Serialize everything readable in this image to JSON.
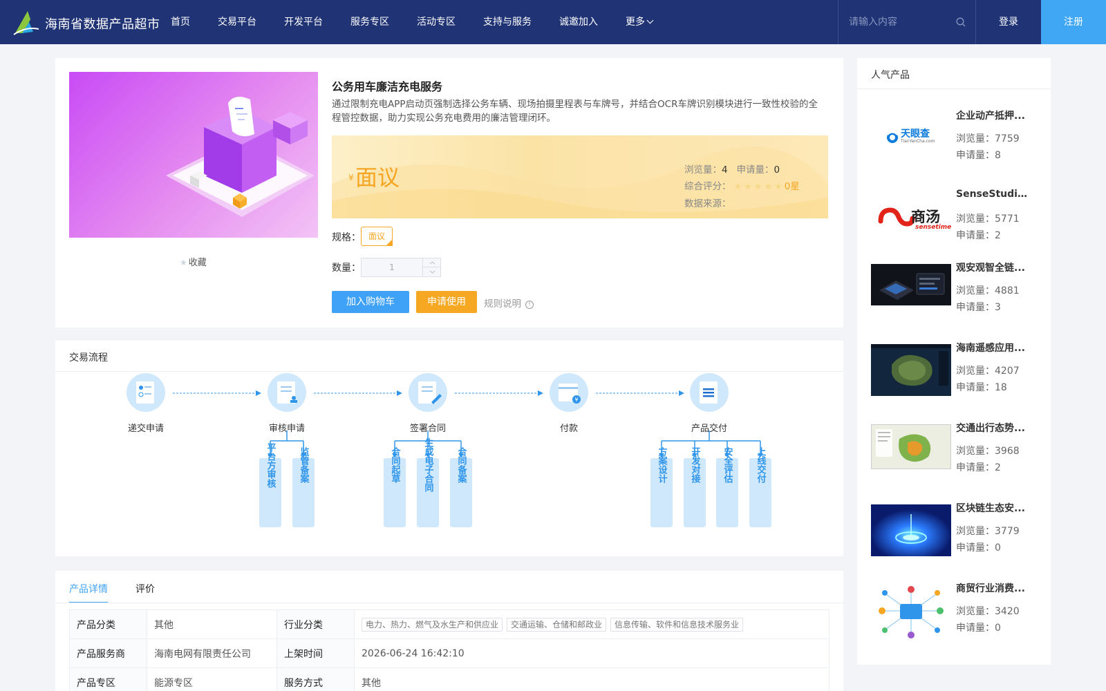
{
  "header": {
    "brand": "海南省数据产品超市",
    "nav": [
      "首页",
      "交易平台",
      "开发平台",
      "服务专区",
      "活动专区",
      "支持与服务",
      "诚邀加入",
      "更多"
    ],
    "search_placeholder": "请输入内容",
    "login": "登录",
    "register": "注册",
    "colors": {
      "bar": "#1f3375",
      "accent": "#3fa7f4"
    }
  },
  "product": {
    "favorite": "收藏",
    "title": "公务用车廉洁充电服务",
    "description": "通过限制充电APP启动页强制选择公务车辆、现场拍摄里程表与车牌号，并结合OCR车牌识别模块进行一致性校验的全程管控数据，助力实现公务充电费用的廉洁管理闭环。",
    "currency": "¥",
    "price": "面议",
    "views_label": "浏览量：",
    "views": "4",
    "applies_label": "申请量：",
    "applies": "0",
    "rating_label": "综合评分：",
    "rating_stars": 0,
    "rating_text": "0星",
    "source_label": "数据来源：",
    "spec_label": "规格：",
    "spec_value": "面议",
    "qty_label": "数量：",
    "qty_value": "1",
    "cart_button": "加入购物车",
    "apply_button": "申请使用",
    "rules_link": "规则说明"
  },
  "flow": {
    "title": "交易流程",
    "steps": [
      "递交申请",
      "审核申请",
      "签署合同",
      "付款",
      "产品交付"
    ],
    "substeps": {
      "审核申请": [
        "平台方审核",
        "监管备案"
      ],
      "签署合同": [
        "合同起草",
        "生成电子合同",
        "合同备案"
      ],
      "产品交付": [
        "方案设计",
        "开发对接",
        "安全评估",
        "上线交付"
      ]
    }
  },
  "detail": {
    "tabs": [
      "产品详情",
      "评价"
    ],
    "rows": [
      {
        "k1": "产品分类",
        "v1": "其他",
        "k2": "行业分类",
        "tags": [
          "电力、热力、燃气及水生产和供应业",
          "交通运输、仓储和邮政业",
          "信息传输、软件和信息技术服务业"
        ]
      },
      {
        "k1": "产品服务商",
        "v1": "海南电网有限责任公司",
        "k2": "上架时间",
        "v2": "2026-06-24 16:42:10"
      },
      {
        "k1": "产品专区",
        "v1": "能源专区",
        "k2": "服务方式",
        "v2": "其他"
      }
    ]
  },
  "sidebar": {
    "title": "人气产品",
    "views_label": "浏览量：",
    "applies_label": "申请量：",
    "items": [
      {
        "name": "企业动产抵押...",
        "views": "7759",
        "applies": "8",
        "thumb": "tianyancha-logo",
        "logo_text": "天眼查",
        "logo_sub": "TianYanCha.com"
      },
      {
        "name": "SenseStudio...",
        "views": "5771",
        "applies": "2",
        "thumb": "sensetime-logo",
        "logo_text": "商汤",
        "logo_sub": "sensetime"
      },
      {
        "name": "观安观智全链...",
        "views": "4881",
        "applies": "3",
        "thumb": "dark-dashboard"
      },
      {
        "name": "海南遥感应用...",
        "views": "4207",
        "applies": "18",
        "thumb": "satellite-map"
      },
      {
        "name": "交通出行态势...",
        "views": "3968",
        "applies": "2",
        "thumb": "traffic-map"
      },
      {
        "name": "区块链生态安...",
        "views": "3779",
        "applies": "0",
        "thumb": "blockchain-glow"
      },
      {
        "name": "商贸行业消费...",
        "views": "3420",
        "applies": "0",
        "thumb": "network-diagram"
      }
    ]
  }
}
